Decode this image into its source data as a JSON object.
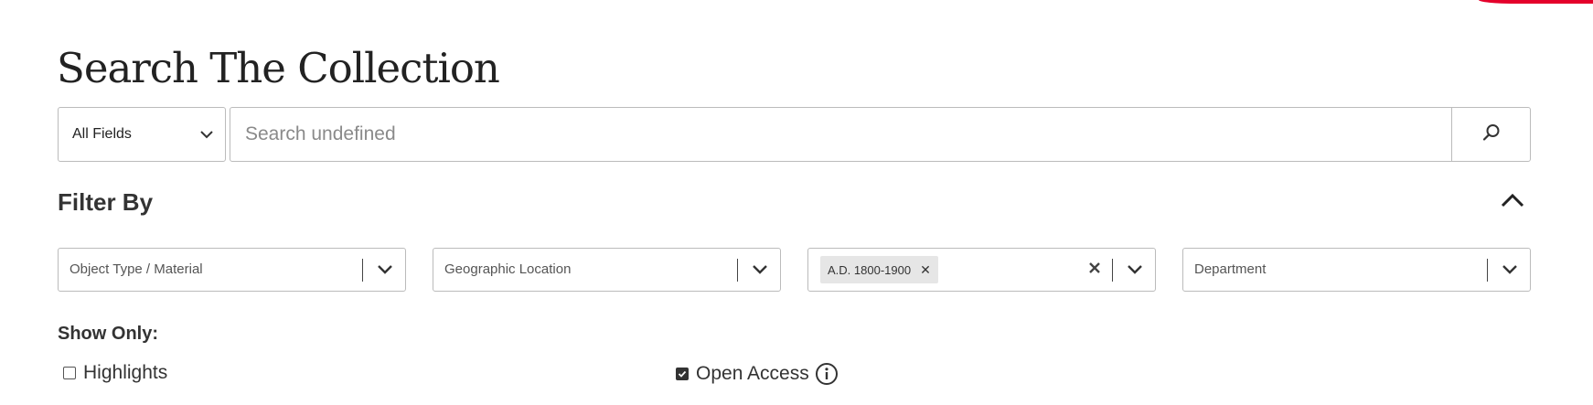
{
  "accent_color": "#e4002b",
  "page": {
    "title": "Search The Collection"
  },
  "search": {
    "field_select": {
      "selected": "All Fields"
    },
    "placeholder": "Search undefined",
    "value": "",
    "button_icon": "search-icon"
  },
  "filters": {
    "title": "Filter By",
    "toggle_icon": "chevron-up-icon",
    "dropdowns": [
      {
        "placeholder": "Object Type / Material",
        "selected": []
      },
      {
        "placeholder": "Geographic Location",
        "selected": []
      },
      {
        "placeholder": "",
        "selected": [
          "A.D. 1800-1900"
        ]
      },
      {
        "placeholder": "Department",
        "selected": []
      }
    ]
  },
  "show_only": {
    "title": "Show Only:",
    "options": [
      {
        "label": "Highlights",
        "checked": false
      },
      {
        "label": "Open Access",
        "checked": true,
        "info_icon": "info-icon"
      }
    ]
  }
}
